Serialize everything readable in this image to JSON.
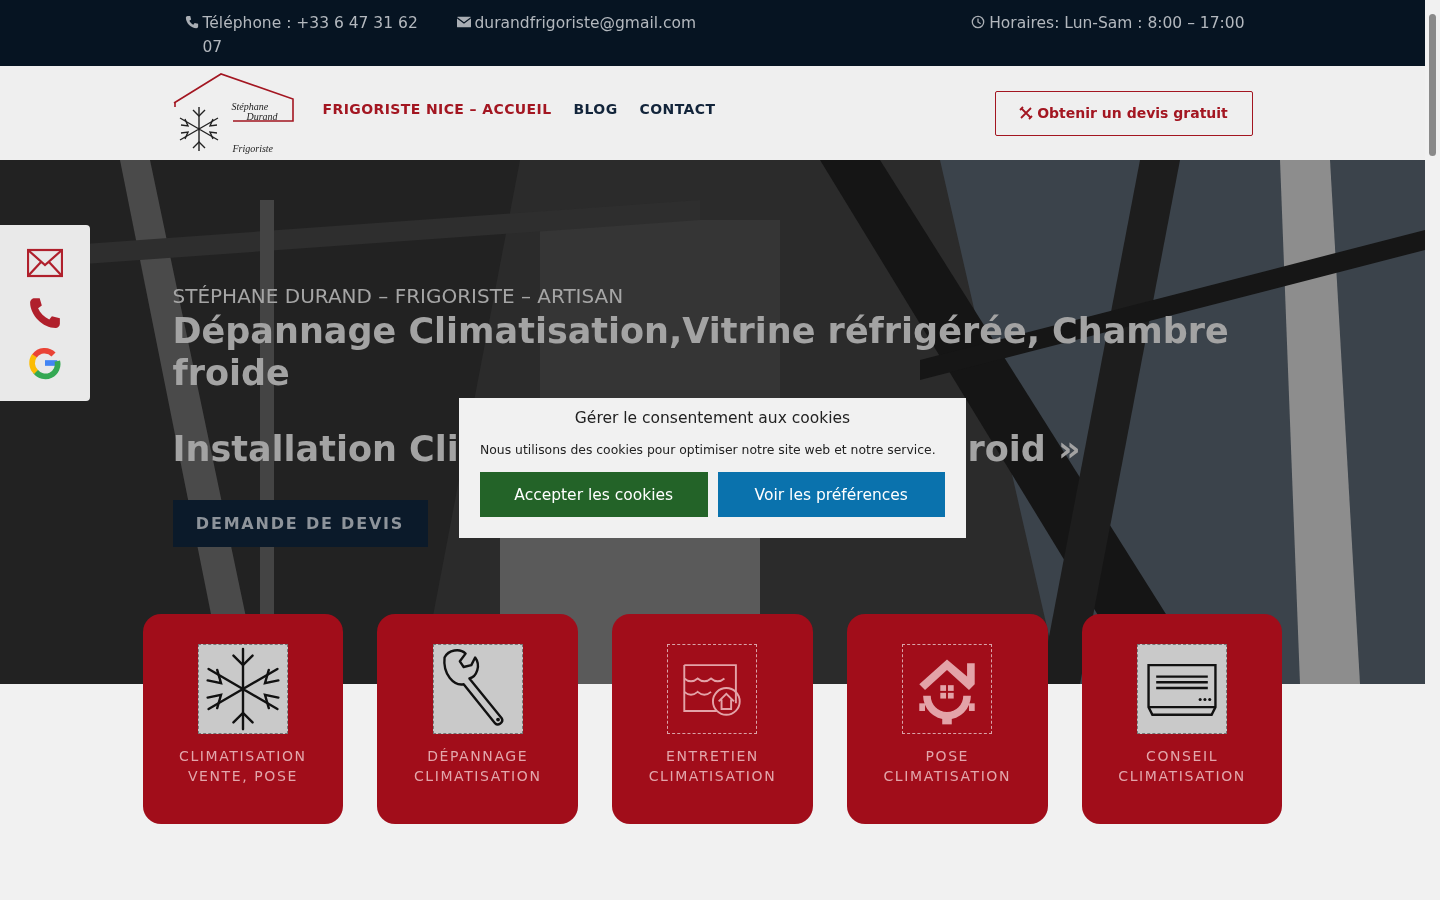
{
  "top_bar": {
    "phone": "Téléphone : +33 6 47 31 62 07",
    "email": "durandfrigoriste@gmail.com",
    "hours": "Horaires: Lun-Sam : 8:00 – 17:00"
  },
  "header": {
    "logo": {
      "first_name": "Stéphane",
      "last_name": "Durand",
      "trade": "Frigoriste"
    },
    "nav": [
      {
        "label": "FRIGORISTE NICE – ACCUEIL",
        "selected": true
      },
      {
        "label": "BLOG",
        "selected": false
      },
      {
        "label": "CONTACT",
        "selected": false
      }
    ],
    "cta": "Obtenir un devis gratuit"
  },
  "hero": {
    "eyebrow": "STÉPHANE DURAND – FRIGORISTE – ARTISAN",
    "title": "Dépannage Climatisation,Vitrine réfrigérée, Chambre froide",
    "subtitle_left": "Installation Cli",
    "subtitle_right": "roid »",
    "button": "DEMANDE DE DEVIS"
  },
  "services": [
    {
      "label": "CLIMATISATION VENTE, POSE",
      "kind": "snowflake",
      "shaded": true
    },
    {
      "label": "DÉPANNAGE CLIMATISATION",
      "kind": "wrench",
      "shaded": true
    },
    {
      "label": "ENTRETIEN CLIMATISATION",
      "kind": "roof",
      "shaded": false
    },
    {
      "label": "POSE CLIMATISATION",
      "kind": "house-gear",
      "shaded": false
    },
    {
      "label": "CONSEIL CLIMATISATION",
      "kind": "ac-unit",
      "shaded": true
    }
  ],
  "cookie_modal": {
    "title": "Gérer le consentement aux cookies",
    "text": "Nous utilisons des cookies pour optimiser notre site web et notre service.",
    "buttons": [
      {
        "label": "Accepter les cookies",
        "kind": "accept"
      },
      {
        "label": "Voir les préférences",
        "kind": "preferences"
      }
    ]
  }
}
